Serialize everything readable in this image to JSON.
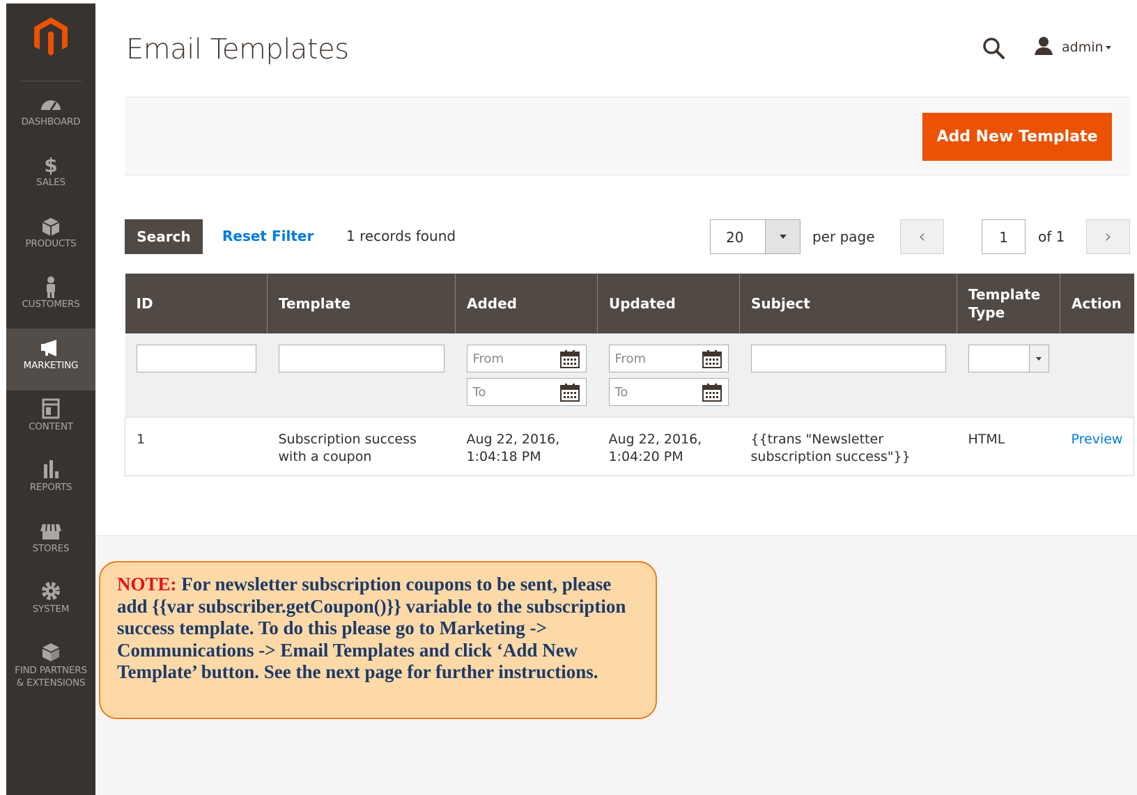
{
  "sidebar": {
    "items": [
      {
        "label": "DASHBOARD",
        "icon": "dashboard-icon"
      },
      {
        "label": "SALES",
        "icon": "dollar-icon"
      },
      {
        "label": "PRODUCTS",
        "icon": "box-icon"
      },
      {
        "label": "CUSTOMERS",
        "icon": "person-icon"
      },
      {
        "label": "MARKETING",
        "icon": "megaphone-icon",
        "active": true
      },
      {
        "label": "CONTENT",
        "icon": "layout-icon"
      },
      {
        "label": "REPORTS",
        "icon": "bar-chart-icon"
      },
      {
        "label": "STORES",
        "icon": "storefront-icon"
      },
      {
        "label": "SYSTEM",
        "icon": "gear-icon"
      },
      {
        "label_line1": "FIND PARTNERS",
        "label_line2": "& EXTENSIONS",
        "icon": "blocks-icon"
      }
    ]
  },
  "header": {
    "title": "Email Templates",
    "user": "admin"
  },
  "actions": {
    "add_new": "Add New Template"
  },
  "toolbar": {
    "search": "Search",
    "reset_filter": "Reset Filter",
    "records_found": "1 records found",
    "per_page_value": "20",
    "per_page_label": "per page",
    "page_current": "1",
    "page_of": "of 1"
  },
  "grid": {
    "columns": [
      "ID",
      "Template",
      "Added",
      "Updated",
      "Subject",
      "Template Type",
      "Action"
    ],
    "filter_placeholders": {
      "from": "From",
      "to": "To"
    },
    "rows": [
      {
        "id": "1",
        "template": "Subscription success with a coupon",
        "added": "Aug 22, 2016, 1:04:18 PM",
        "updated": "Aug 22, 2016, 1:04:20 PM",
        "subject": "{{trans \"Newsletter subscription success\"}}",
        "type": "HTML",
        "action": "Preview"
      }
    ]
  },
  "note": {
    "label": "NOTE:",
    "text": "For newsletter subscription coupons to be sent, please add {{var subscriber.getCoupon()}} variable to the subscription success template. To do this please go to Marketing -> Communications -> Email Templates and click ‘Add New Template’ button. See the next page for further instructions."
  },
  "colors": {
    "sidebar_bg": "#373330",
    "accent": "#eb5202",
    "header_bg": "#514943",
    "link": "#007bdb",
    "note_bg": "#fdd9a8",
    "note_border": "#ef7d19"
  }
}
